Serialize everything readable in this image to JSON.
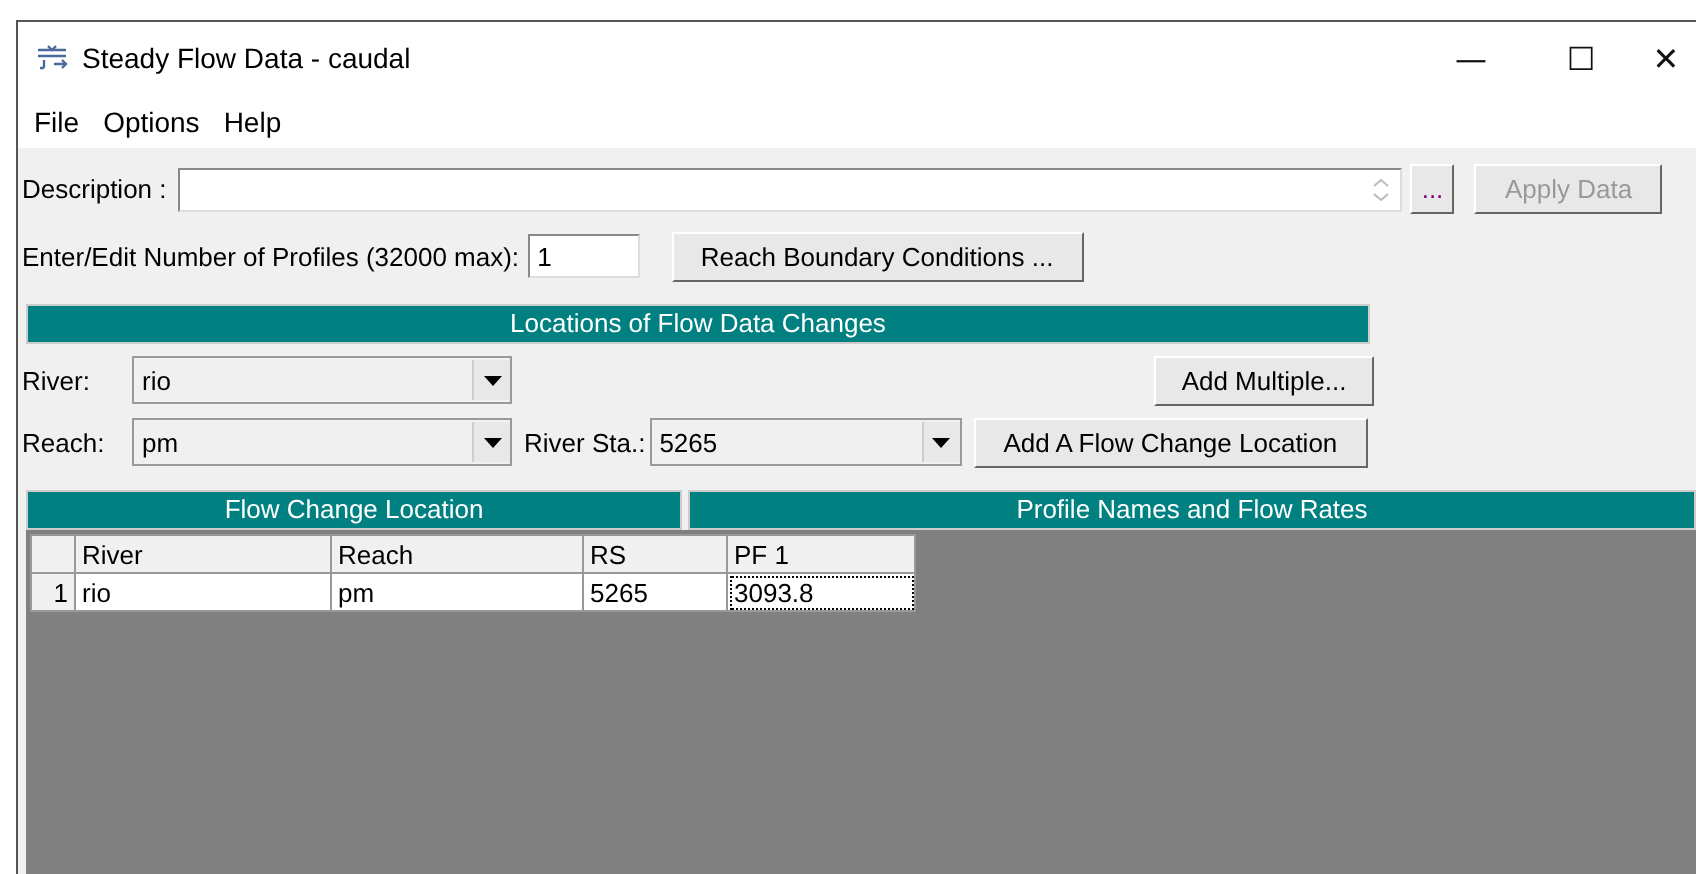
{
  "window": {
    "title": "Steady Flow Data - caudal",
    "controls": {
      "minimize": "—",
      "maximize": "☐",
      "close": "✕"
    }
  },
  "menu": [
    "File",
    "Options",
    "Help"
  ],
  "description": {
    "label": "Description :",
    "more_button": "...",
    "apply_button": {
      "label": "Apply Data",
      "disabled": true
    }
  },
  "profiles": {
    "label": "Enter/Edit Number of Profiles (32000 max):",
    "value": "1",
    "boundary_button": "Reach Boundary Conditions ..."
  },
  "locations": {
    "title": "Locations of Flow Data Changes",
    "river_label": "River:",
    "river": "rio",
    "reach_label": "Reach:",
    "reach": "pm",
    "station_label": "River Sta.:",
    "station": "5265",
    "add_multiple": "Add Multiple...",
    "add_location": "Add A Flow Change Location"
  },
  "table": {
    "left_title": "Flow Change Location",
    "right_title": "Profile Names and Flow Rates",
    "columns": [
      "River",
      "Reach",
      "RS",
      "PF 1"
    ],
    "rows": [
      {
        "number": "1",
        "cells": [
          {
            "text": "rio",
            "focused": false
          },
          {
            "text": "pm",
            "focused": false
          },
          {
            "text": "5265",
            "focused": false
          },
          {
            "text": "3093.8",
            "focused": true
          }
        ]
      }
    ]
  }
}
